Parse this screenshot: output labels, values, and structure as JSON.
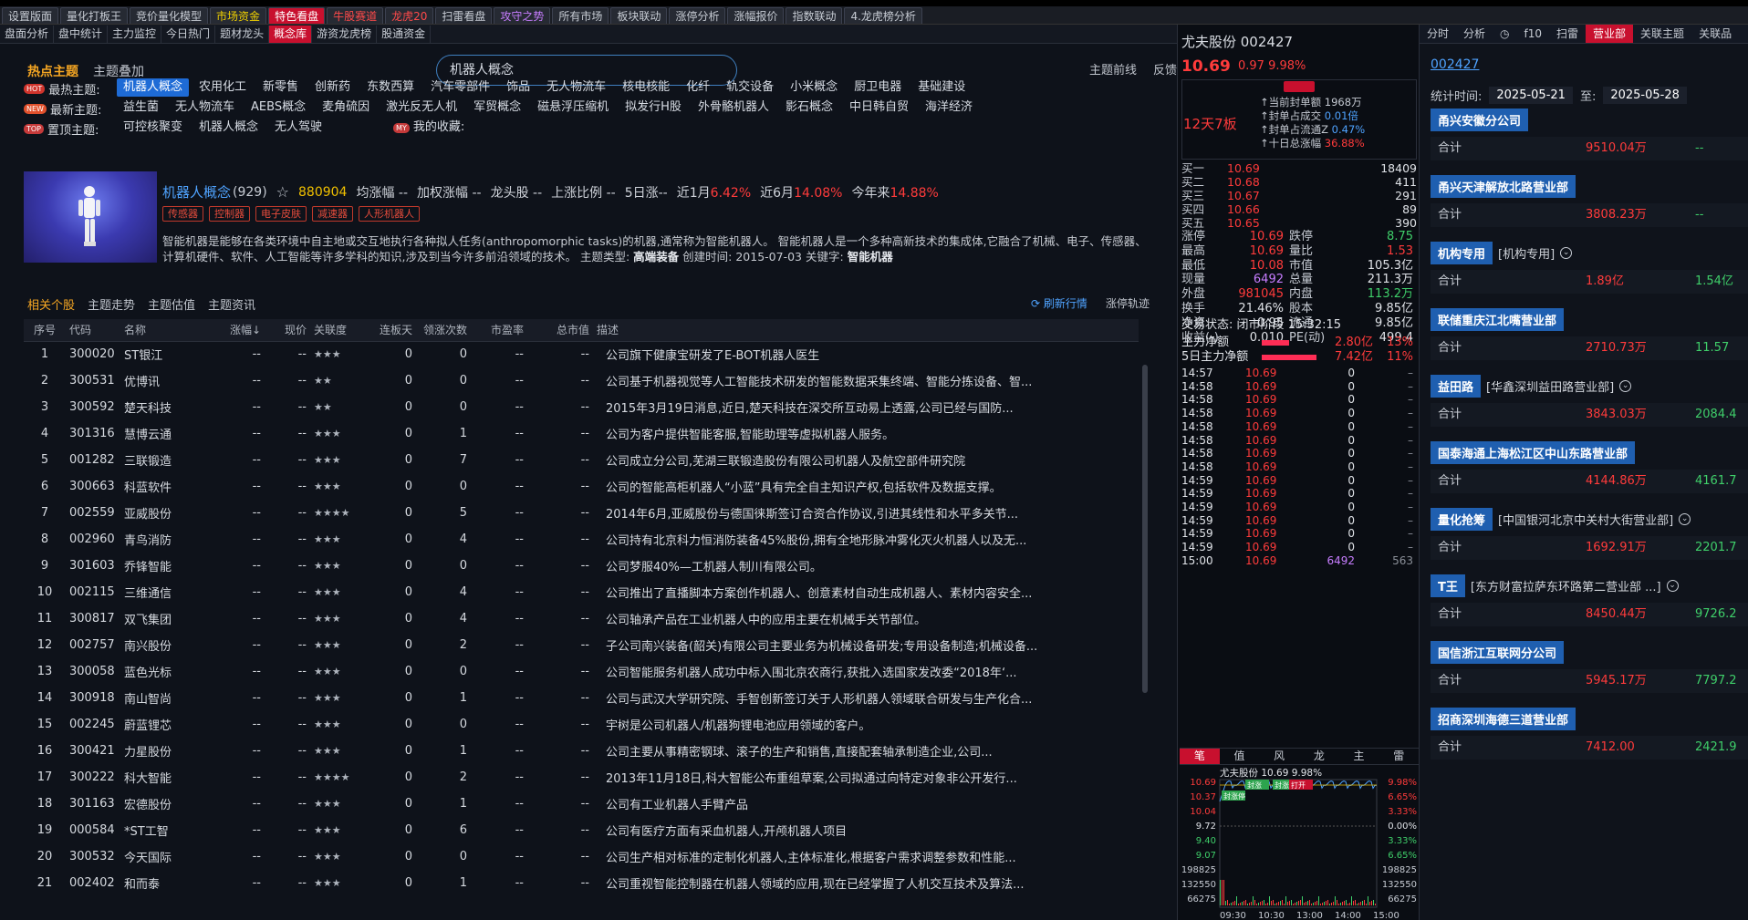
{
  "topstrip_text": "",
  "tabs1": [
    {
      "label": "设置版面",
      "cls": ""
    },
    {
      "label": "量化打板王",
      "cls": ""
    },
    {
      "label": "竞价量化模型",
      "cls": ""
    },
    {
      "label": "市场资金",
      "cls": "y"
    },
    {
      "label": "特色看盘",
      "cls": "active"
    },
    {
      "label": "牛股赛道",
      "cls": "r"
    },
    {
      "label": "龙虎20",
      "cls": "r"
    },
    {
      "label": "扫雷看盘",
      "cls": ""
    },
    {
      "label": "攻守之势",
      "cls": "p"
    },
    {
      "label": "所有市场",
      "cls": ""
    },
    {
      "label": "板块联动",
      "cls": ""
    },
    {
      "label": "涨停分析",
      "cls": ""
    },
    {
      "label": "涨幅报价",
      "cls": ""
    },
    {
      "label": "指数联动",
      "cls": ""
    },
    {
      "label": "4.龙虎榜分析",
      "cls": ""
    }
  ],
  "tabs2": [
    {
      "label": "盘面分析",
      "active": false
    },
    {
      "label": "盘中统计",
      "active": false
    },
    {
      "label": "主力监控",
      "active": false
    },
    {
      "label": "今日热门",
      "active": false
    },
    {
      "label": "题材龙头",
      "active": false
    },
    {
      "label": "概念库",
      "active": true
    },
    {
      "label": "游资龙虎榜",
      "active": false
    },
    {
      "label": "股通资金",
      "active": false
    }
  ],
  "topic_tabs": {
    "hot": "热点主题",
    "overlay": "主题叠加"
  },
  "search_value": "机器人概念",
  "top_links": {
    "frontline": "主题前线",
    "feedback": "反馈"
  },
  "rows": [
    {
      "label": "最热主题:",
      "badge": "HOT",
      "items": [
        "机器人概念",
        "农用化工",
        "新零售",
        "创新药",
        "东数西算",
        "汽车零部件",
        "饰品",
        "无人物流车",
        "核电核能",
        "化纤",
        "轨交设备",
        "小米概念",
        "厨卫电器",
        "基础建设"
      ],
      "selected": 0
    },
    {
      "label": "最新主题:",
      "badge": "NEW",
      "items": [
        "益生菌",
        "无人物流车",
        "AEBS概念",
        "麦角硫因",
        "激光反无人机",
        "军贸概念",
        "磁悬浮压缩机",
        "拟发行H股",
        "外骨骼机器人",
        "影石概念",
        "中日韩自贸",
        "海洋经济"
      ],
      "selected": -1
    },
    {
      "label": "置顶主题:",
      "badge": "TOP",
      "items": [
        "可控核聚变",
        "机器人概念",
        "无人驾驶"
      ],
      "selected": -1,
      "mine": "我的收藏:"
    }
  ],
  "concept": {
    "name": "机器人概念",
    "count": "(929)",
    "star": "☆",
    "code": "880904",
    "avg_label": "均涨幅 --",
    "add_label": "加权涨幅 --",
    "leader_label": "龙头股 --",
    "ratio_label": "上涨比例 --",
    "d5_label": "5日涨--",
    "m1_label": "近1月",
    "m1_val": "6.42%",
    "m6_label": "近6月",
    "m6_val": "14.08%",
    "ytd_label": "今年来",
    "ytd_val": "14.88%",
    "tags": [
      "传感器",
      "控制器",
      "电子皮肤",
      "减速器",
      "人形机器人"
    ],
    "desc": "智能机器是能够在各类环境中自主地或交互地执行各种拟人任务(anthropomorphic tasks)的机器,通常称为智能机器人。 智能机器人是一个多种高新技术的集成体,它融合了机械、电子、传感器、计算机硬件、软件、人工智能等许多学科的知识,涉及到当今许多前沿领域的技术。 主题类型:",
    "desc_type": "高端装备",
    "desc_created": "创建时间:",
    "desc_date": "2015-07-03",
    "desc_kw": "关键字:",
    "desc_kwv": "智能机器"
  },
  "subtabs": [
    "相关个股",
    "主题走势",
    "主题估值",
    "主题资讯"
  ],
  "refresh": "刷新行情",
  "track": "涨停轨迹",
  "columns": [
    "序号",
    "代码",
    "名称",
    "涨幅↓",
    "现价",
    "关联度",
    "连板天",
    "领涨次数",
    "市盈率",
    "总市值",
    "描述"
  ],
  "stocks": [
    [
      "1",
      "300020",
      "ST银江",
      "--",
      "--",
      "★★★",
      "0",
      "0",
      "--",
      "--",
      "公司旗下健康宝研发了E-BOT机器人医生"
    ],
    [
      "2",
      "300531",
      "优博讯",
      "--",
      "--",
      "★★",
      "0",
      "0",
      "--",
      "--",
      "公司基于机器视觉等人工智能技术研发的智能数据采集终端、智能分拣设备、智..."
    ],
    [
      "3",
      "300592",
      "楚天科技",
      "--",
      "--",
      "★★",
      "0",
      "0",
      "--",
      "--",
      "2015年3月19日消息,近日,楚天科技在深交所互动易上透露,公司已经与国防..."
    ],
    [
      "4",
      "301316",
      "慧博云通",
      "--",
      "--",
      "★★★",
      "0",
      "1",
      "--",
      "--",
      "公司为客户提供智能客服,智能助理等虚拟机器人服务。"
    ],
    [
      "5",
      "001282",
      "三联锻造",
      "--",
      "--",
      "★★★",
      "0",
      "7",
      "--",
      "--",
      "公司成立分公司,芜湖三联锻造股份有限公司机器人及航空部件研究院"
    ],
    [
      "6",
      "300663",
      "科蓝软件",
      "--",
      "--",
      "★★★",
      "0",
      "0",
      "--",
      "--",
      "公司的智能高柜机器人“小蓝”具有完全自主知识产权,包括软件及数据支撑。"
    ],
    [
      "7",
      "002559",
      "亚威股份",
      "--",
      "--",
      "★★★★",
      "0",
      "5",
      "--",
      "--",
      "2014年6月,亚威股份与德国徕斯签订合资合作协议,引进其线性和水平多关节..."
    ],
    [
      "8",
      "002960",
      "青鸟消防",
      "--",
      "--",
      "★★★",
      "0",
      "4",
      "--",
      "--",
      "公司持有北京科力恒消防装备45%股份,拥有全地形脉冲雾化灭火机器人以及无..."
    ],
    [
      "9",
      "301603",
      "乔锋智能",
      "--",
      "--",
      "★★★",
      "0",
      "0",
      "--",
      "--",
      "公司梦服40%—工机器人制川有限公司。"
    ],
    [
      "10",
      "002115",
      "三维通信",
      "--",
      "--",
      "★★★",
      "0",
      "4",
      "--",
      "--",
      "公司推出了直播脚本方案创作机器人、创意素材自动生成机器人、素材内容安全..."
    ],
    [
      "11",
      "300817",
      "双飞集团",
      "--",
      "--",
      "★★★",
      "0",
      "4",
      "--",
      "--",
      "公司轴承产品在工业机器人中的应用主要在机械手关节部位。"
    ],
    [
      "12",
      "002757",
      "南兴股份",
      "--",
      "--",
      "★★★",
      "0",
      "2",
      "--",
      "--",
      "子公司南兴装备(韶关)有限公司主要业务为机械设备研发;专用设备制造;机械设备..."
    ],
    [
      "13",
      "300058",
      "蓝色光标",
      "--",
      "--",
      "★★★",
      "0",
      "0",
      "--",
      "--",
      "公司智能服务机器人成功中标入围北京农商行,获批入选国家发改委“2018年‘..."
    ],
    [
      "14",
      "300918",
      "南山智尚",
      "--",
      "--",
      "★★★",
      "0",
      "1",
      "--",
      "--",
      "公司与武汉大学研究院、手智创新签订关于人形机器人领域联合研发与生产化合..."
    ],
    [
      "15",
      "002245",
      "蔚蓝锂芯",
      "--",
      "--",
      "★★★",
      "0",
      "0",
      "--",
      "--",
      "宇树是公司机器人/机器狗锂电池应用领域的客户。"
    ],
    [
      "16",
      "300421",
      "力星股份",
      "--",
      "--",
      "★★★",
      "0",
      "1",
      "--",
      "--",
      "公司主要从事精密钢球、滚子的生产和销售,直接配套轴承制造企业,公司..."
    ],
    [
      "17",
      "300222",
      "科大智能",
      "--",
      "--",
      "★★★★",
      "0",
      "2",
      "--",
      "--",
      "2013年11月18日,科大智能公布重组草案,公司拟通过向特定对象非公开发行..."
    ],
    [
      "18",
      "301163",
      "宏德股份",
      "--",
      "--",
      "★★★",
      "0",
      "1",
      "--",
      "--",
      "公司有工业机器人手臂产品"
    ],
    [
      "19",
      "000584",
      "*ST工智",
      "--",
      "--",
      "★★★",
      "0",
      "6",
      "--",
      "--",
      "公司有医疗方面有采血机器人,开颅机器人项目"
    ],
    [
      "20",
      "300532",
      "今天国际",
      "--",
      "--",
      "★★★",
      "0",
      "0",
      "--",
      "--",
      "公司生产相对标准的定制化机器人,主体标准化,根据客户需求调整参数和性能..."
    ],
    [
      "21",
      "002402",
      "和而泰",
      "--",
      "--",
      "★★★",
      "0",
      "1",
      "--",
      "--",
      "公司重视智能控制器在机器人领域的应用,现在已经掌握了人机交互技术及算法..."
    ]
  ],
  "quote": {
    "title": "尤夫股份 002427",
    "price": "10.69",
    "chg": "0.97  9.98%",
    "lianban": "12天7板",
    "seal": [
      [
        "当前封单额",
        "1968万",
        ""
      ],
      [
        "封单占成交",
        "0.01倍",
        "b"
      ],
      [
        "封单占流通Z",
        "0.47%",
        "b"
      ],
      [
        "十日总涨幅",
        "36.88%",
        "r"
      ]
    ],
    "orderbook": [
      [
        "买一",
        "10.69",
        "18409"
      ],
      [
        "买二",
        "10.68",
        "411"
      ],
      [
        "买三",
        "10.67",
        "291"
      ],
      [
        "买四",
        "10.66",
        "89"
      ],
      [
        "买五",
        "10.65",
        "390"
      ]
    ],
    "stats": [
      [
        "涨停",
        "10.69",
        "跌停",
        "8.75"
      ],
      [
        "最高",
        "10.69",
        "量比",
        "1.53"
      ],
      [
        "最低",
        "10.08",
        "市值",
        "105.3亿"
      ],
      [
        "现量",
        "6492",
        "总量",
        "211.3万"
      ],
      [
        "外盘",
        "981045",
        "内盘",
        "113.2万"
      ],
      [
        "换手",
        "21.46%",
        "股本",
        "9.85亿"
      ],
      [
        "净资",
        "0.95",
        "流通",
        "9.85亿"
      ],
      [
        "收益(-)",
        "0.010",
        "PE(动)",
        "499.4"
      ]
    ],
    "status": "交易状态: 闭市阶段 15:32:15",
    "flows": [
      [
        "主力净额",
        "2.80亿",
        "13%"
      ],
      [
        "5日主力净额",
        "7.42亿",
        "11%"
      ]
    ],
    "ticks": [
      [
        "14:57",
        "10.69",
        "0",
        "–"
      ],
      [
        "14:58",
        "10.69",
        "0",
        "–"
      ],
      [
        "14:58",
        "10.69",
        "0",
        "–"
      ],
      [
        "14:58",
        "10.69",
        "0",
        "–"
      ],
      [
        "14:58",
        "10.69",
        "0",
        "–"
      ],
      [
        "14:58",
        "10.69",
        "0",
        "–"
      ],
      [
        "14:58",
        "10.69",
        "0",
        "–"
      ],
      [
        "14:58",
        "10.69",
        "0",
        "–"
      ],
      [
        "14:59",
        "10.69",
        "0",
        "–"
      ],
      [
        "14:59",
        "10.69",
        "0",
        "–"
      ],
      [
        "14:59",
        "10.69",
        "0",
        "–"
      ],
      [
        "14:59",
        "10.69",
        "0",
        "–"
      ],
      [
        "14:59",
        "10.69",
        "0",
        "–"
      ],
      [
        "14:59",
        "10.69",
        "0",
        "–"
      ],
      [
        "15:00",
        "10.69",
        "6492",
        "563"
      ]
    ],
    "mini_tabs": [
      "笔",
      "值",
      "风",
      "龙",
      "主",
      "雷"
    ],
    "mini_title": "尤夫股份  10.69  9.98%",
    "mini_left": [
      "10.69",
      "10.37",
      "10.04",
      "9.72",
      "9.40",
      "9.07",
      "198825",
      "132550",
      "66275"
    ],
    "mini_right": [
      "9.98%",
      "6.65%",
      "3.33%",
      "0.00%",
      "3.33%",
      "6.65%",
      "198825",
      "132550",
      "66275"
    ],
    "mini_x": [
      "09:30",
      "10:30",
      "13:00",
      "14:00",
      "15:00"
    ],
    "mini_tags": [
      "封涨停",
      "封涨",
      "封涨",
      "打开"
    ]
  },
  "right": {
    "tabs": [
      {
        "label": "分时",
        "active": false
      },
      {
        "label": "分析",
        "active": false
      },
      {
        "label": "◷",
        "active": false
      },
      {
        "label": "f10",
        "active": false
      },
      {
        "label": "扫雷",
        "active": false
      },
      {
        "label": "营业部",
        "active": true
      },
      {
        "label": "关联主题",
        "active": false
      },
      {
        "label": "关联品",
        "active": false
      }
    ],
    "code": "002427",
    "date_label": "统计时间:",
    "date_from": "2025-05-21",
    "date_to_label": "至:",
    "date_to": "2025-05-28",
    "brokers": [
      {
        "label": "甬兴安徽分公司",
        "sub": "",
        "chev": false,
        "total": "合计",
        "b": "9510.04万",
        "c": "--"
      },
      {
        "label": "甬兴天津解放北路营业部",
        "sub": "",
        "chev": false,
        "total": "合计",
        "b": "3808.23万",
        "c": "--"
      },
      {
        "label": "机构专用",
        "sub": "[机构专用]",
        "chev": true,
        "total": "合计",
        "b": "1.89亿",
        "c": "1.54亿"
      },
      {
        "label": "联储重庆江北嘴营业部",
        "sub": "",
        "chev": false,
        "total": "合计",
        "b": "2710.73万",
        "c": "11.57"
      },
      {
        "label": "益田路",
        "sub": "[华鑫深圳益田路营业部]",
        "chev": true,
        "total": "合计",
        "b": "3843.03万",
        "c": "2084.4"
      },
      {
        "label": "国泰海通上海松江区中山东路营业部",
        "sub": "",
        "chev": false,
        "total": "合计",
        "b": "4144.86万",
        "c": "4161.7"
      },
      {
        "label": "量化抢筹",
        "sub": "[中国银河北京中关村大街营业部]",
        "chev": true,
        "total": "合计",
        "b": "1692.91万",
        "c": "2201.7"
      },
      {
        "label": "T王",
        "sub": "[东方财富拉萨东环路第二营业部 ...]",
        "chev": true,
        "total": "合计",
        "b": "8450.44万",
        "c": "9726.2"
      },
      {
        "label": "国信浙江互联网分公司",
        "sub": "",
        "chev": false,
        "total": "合计",
        "b": "5945.17万",
        "c": "7797.2"
      },
      {
        "label": "招商深圳海德三道营业部",
        "sub": "",
        "chev": false,
        "total": "合计",
        "b": "7412.00",
        "c": "2421.9"
      }
    ]
  }
}
